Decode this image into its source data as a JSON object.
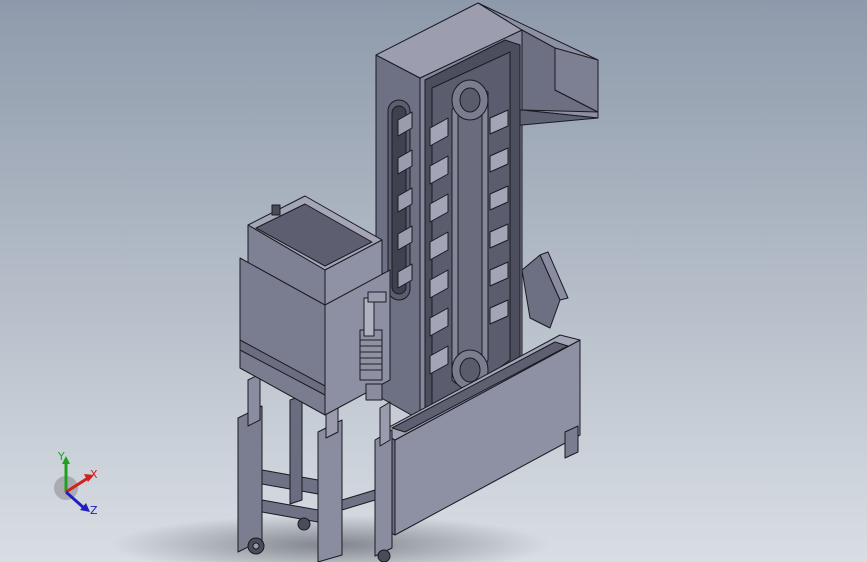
{
  "viewport": {
    "background_top": "#8e9aab",
    "background_bottom": "#d9dee4",
    "model_face_light": "#8a8c9e",
    "model_face_mid": "#6f7184",
    "model_face_dark": "#55576a",
    "edge_color": "#1a1a22"
  },
  "triad": {
    "x_label": "X",
    "y_label": "Y",
    "z_label": "Z",
    "x_color": "#d02020",
    "y_color": "#20a020",
    "z_color": "#2020c0"
  }
}
